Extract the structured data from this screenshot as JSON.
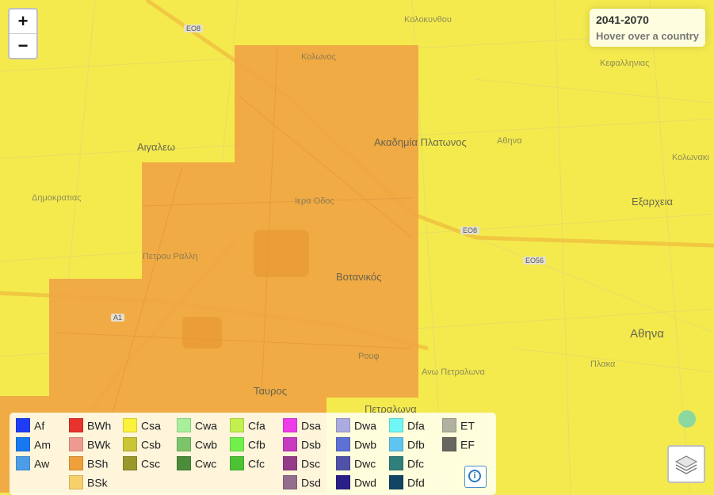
{
  "info": {
    "period": "2041-2070",
    "hint": "Hover over a country"
  },
  "zoom": {
    "in_label": "+",
    "out_label": "−"
  },
  "legend": {
    "items": [
      {
        "code": "Af",
        "color": "#1f3cf5"
      },
      {
        "code": "Am",
        "color": "#1779f0"
      },
      {
        "code": "Aw",
        "color": "#4c9de8"
      },
      {
        "code": "BWh",
        "color": "#e8322d"
      },
      {
        "code": "BWk",
        "color": "#ef9a90"
      },
      {
        "code": "BSh",
        "color": "#f0a03a"
      },
      {
        "code": "BSk",
        "color": "#f7d06a"
      },
      {
        "code": "Csa",
        "color": "#faf23b"
      },
      {
        "code": "Csb",
        "color": "#c9c534"
      },
      {
        "code": "Csc",
        "color": "#9a972c"
      },
      {
        "code": "Cwa",
        "color": "#a7ef9c"
      },
      {
        "code": "Cwb",
        "color": "#7cc46a"
      },
      {
        "code": "Cwc",
        "color": "#4c8b3a"
      },
      {
        "code": "Cfa",
        "color": "#c4f04f"
      },
      {
        "code": "Cfb",
        "color": "#72ef4c"
      },
      {
        "code": "Cfc",
        "color": "#4ec235"
      },
      {
        "code": "Dsa",
        "color": "#ee3ce9"
      },
      {
        "code": "Dsb",
        "color": "#c73ac0"
      },
      {
        "code": "Dsc",
        "color": "#943c8a"
      },
      {
        "code": "Dsd",
        "color": "#926d8c"
      },
      {
        "code": "Dwa",
        "color": "#acabe0"
      },
      {
        "code": "Dwb",
        "color": "#5d70d6"
      },
      {
        "code": "Dwc",
        "color": "#4f52a8"
      },
      {
        "code": "Dwd",
        "color": "#2a1e88"
      },
      {
        "code": "Dfa",
        "color": "#6ff6f5"
      },
      {
        "code": "Dfb",
        "color": "#5ec5f0"
      },
      {
        "code": "Dfc",
        "color": "#2f7f7a"
      },
      {
        "code": "Dfd",
        "color": "#124464"
      },
      {
        "code": "ET",
        "color": "#b1b1a0"
      },
      {
        "code": "EF",
        "color": "#676760"
      }
    ]
  },
  "map": {
    "place_labels": [
      {
        "text": "Αιγαλεω",
        "big": true
      },
      {
        "text": "Ακαδημία Πλατωνος",
        "big": true
      },
      {
        "text": "Βοτανικός",
        "big": true
      },
      {
        "text": "Αθηνα",
        "big": true
      },
      {
        "text": "Εξαρχεια",
        "big": true
      },
      {
        "text": "Ταυρος",
        "big": true
      },
      {
        "text": "Πετραλωνα",
        "big": true
      },
      {
        "text": "Κολωνος",
        "big": false
      },
      {
        "text": "Ιερα Οδος",
        "big": false
      },
      {
        "text": "Πλακα",
        "big": false
      },
      {
        "text": "Ανω Πετραλωνα",
        "big": false
      },
      {
        "text": "Ρουφ",
        "big": false
      },
      {
        "text": "Κολοκυνθου",
        "big": false
      },
      {
        "text": "Αθηνα",
        "big": false
      },
      {
        "text": "Πετρου Ραλλη",
        "big": false
      },
      {
        "text": "Δημοκρατιας",
        "big": false
      },
      {
        "text": "Κεφαλληνιας",
        "big": false
      },
      {
        "text": "Κολωνακι",
        "big": false
      }
    ],
    "road_labels": [
      "ΕΟ8",
      "ΕΟ8",
      "ΕΟ56",
      "Α1"
    ],
    "climate_zones": {
      "base": "Csa",
      "patch": "BSh"
    }
  }
}
